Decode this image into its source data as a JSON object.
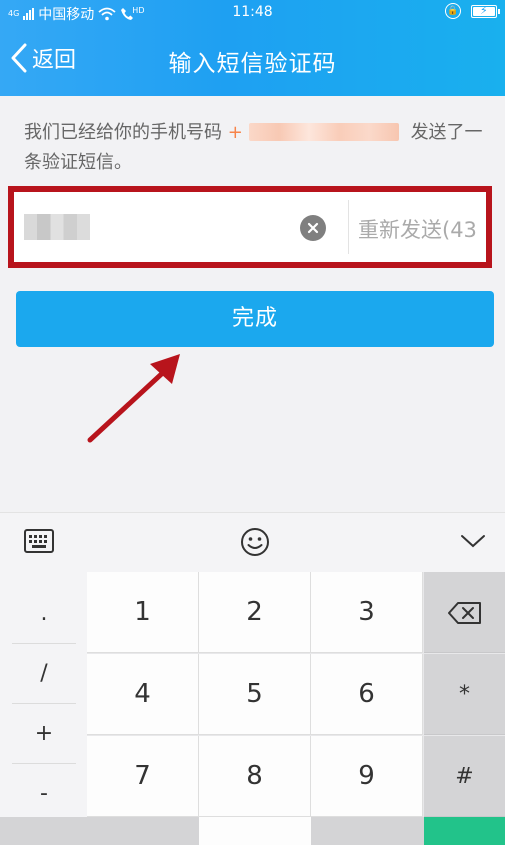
{
  "status_bar": {
    "network_badge": "4G",
    "carrier": "中国移动",
    "hd_badge": "HD",
    "time": "11:48"
  },
  "header": {
    "back_label": "返回",
    "title": "输入短信验证码"
  },
  "info": {
    "prefix": "我们已经给你的手机号码",
    "phone_masked_prefix": "+",
    "suffix": "发送了一条验证短信。"
  },
  "code_input": {
    "resend_label": "重新发送(43"
  },
  "done_button": {
    "label": "完成"
  },
  "keyboard": {
    "symbols": [
      ".",
      "/",
      "+",
      "-"
    ],
    "digit_rows": [
      [
        "1",
        "2",
        "3"
      ],
      [
        "4",
        "5",
        "6"
      ],
      [
        "7",
        "8",
        "9"
      ]
    ],
    "side_keys": [
      "*",
      "#"
    ]
  },
  "colors": {
    "header_blue": "#1ea0f2",
    "button_blue": "#1ba8ee",
    "highlight_red": "#b8141c",
    "phone_orange": "#f7844a"
  }
}
